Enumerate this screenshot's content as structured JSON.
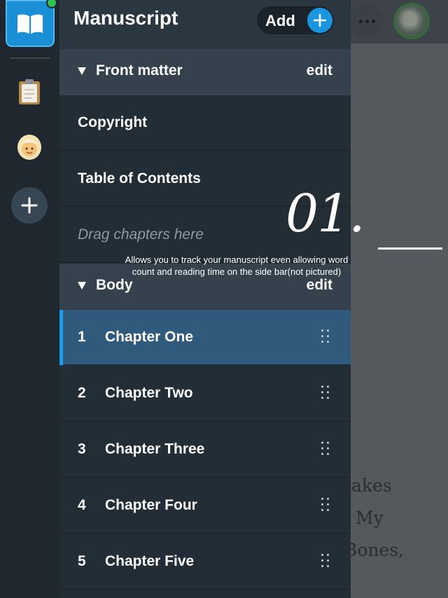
{
  "panel": {
    "title": "Manuscript",
    "add_label": "Add"
  },
  "front_matter": {
    "label": "Front matter",
    "edit_label": "edit",
    "items": [
      "Copyright",
      "Table of Contents"
    ],
    "drop_placeholder": "Drag chapters here"
  },
  "body_section": {
    "label": "Body",
    "edit_label": "edit",
    "chapters": [
      {
        "number": "1",
        "title": "Chapter One",
        "active": true
      },
      {
        "number": "2",
        "title": "Chapter Two",
        "active": false
      },
      {
        "number": "3",
        "title": "Chapter Three",
        "active": false
      },
      {
        "number": "4",
        "title": "Chapter Four",
        "active": false
      },
      {
        "number": "5",
        "title": "Chapter Five",
        "active": false
      }
    ]
  },
  "overlay": {
    "number": "01.",
    "caption_line1": "Allows you to track your manuscript even allowing word",
    "caption_line2": "count and reading time on the side bar(not pictured)"
  },
  "background_text": [
    "takes",
    "My",
    "Bones,"
  ],
  "rail": {
    "icons": [
      "book-icon",
      "clipboard-icon",
      "person-icon",
      "add-icon"
    ]
  },
  "colors": {
    "accent": "#1a95e0",
    "active_row": "#2f5a7c",
    "panel_bg": "#232d35",
    "section_bg": "#35424d",
    "rail_bg": "#1f282f",
    "status_dot": "#2fc153"
  }
}
